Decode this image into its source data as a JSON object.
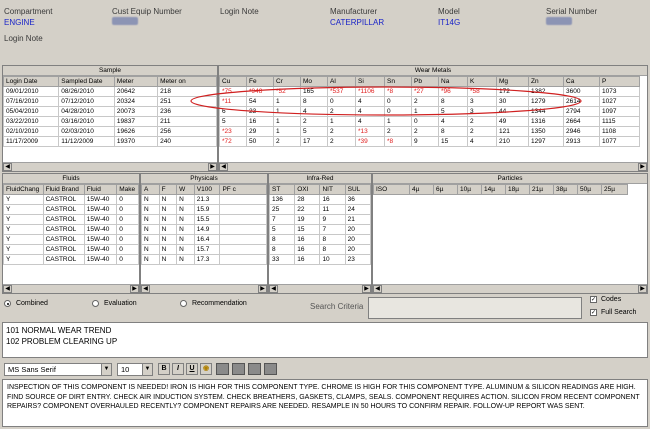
{
  "header": {
    "compartment_label": "Compartment",
    "compartment_value": "ENGINE",
    "login_note_label_left": "Login Note",
    "cust_equip_label": "Cust Equip Number",
    "login_note_label": "Login Note",
    "manufacturer_label": "Manufacturer",
    "manufacturer_value": "CATERPILLAR",
    "model_label": "Model",
    "model_value": "IT14G",
    "serial_label": "Serial Number"
  },
  "sample": {
    "title": "Sample",
    "columns": [
      "Login Date",
      "Sampled Date",
      "Meter",
      "Meter on"
    ],
    "rows": [
      [
        "09/01/2010",
        "08/26/2010",
        "20642",
        "218"
      ],
      [
        "07/16/2010",
        "07/12/2010",
        "20324",
        "251"
      ],
      [
        "05/04/2010",
        "04/28/2010",
        "20073",
        "236"
      ],
      [
        "03/22/2010",
        "03/16/2010",
        "19837",
        "211"
      ],
      [
        "02/10/2010",
        "02/03/2010",
        "19626",
        "256"
      ],
      [
        "11/17/2009",
        "11/12/2009",
        "19370",
        "240"
      ]
    ]
  },
  "wear": {
    "title": "Wear Metals",
    "columns": [
      "Cu",
      "Fe",
      "Cr",
      "Mo",
      "Al",
      "Si",
      "Sn",
      "Pb",
      "Na",
      "K",
      "Mg",
      "Zn",
      "Ca",
      "P"
    ],
    "rows": [
      [
        "*75",
        "*948",
        "*52",
        "165",
        "*537",
        "*1106",
        "*8",
        "*27",
        "*96",
        "*58",
        "172",
        "1382",
        "3600",
        "1073"
      ],
      [
        "*11",
        "54",
        "1",
        "8",
        "0",
        "4",
        "0",
        "2",
        "8",
        "3",
        "30",
        "1279",
        "2614",
        "1027"
      ],
      [
        "6",
        "23",
        "1",
        "4",
        "2",
        "4",
        "0",
        "1",
        "5",
        "3",
        "44",
        "1344",
        "2794",
        "1097"
      ],
      [
        "5",
        "16",
        "1",
        "2",
        "1",
        "4",
        "1",
        "0",
        "4",
        "2",
        "49",
        "1316",
        "2664",
        "1115"
      ],
      [
        "*23",
        "29",
        "1",
        "5",
        "2",
        "*13",
        "2",
        "2",
        "8",
        "2",
        "121",
        "1350",
        "2946",
        "1108"
      ],
      [
        "*72",
        "50",
        "2",
        "17",
        "2",
        "*39",
        "*8",
        "9",
        "15",
        "4",
        "210",
        "1297",
        "2913",
        "1077"
      ]
    ]
  },
  "fluids": {
    "title": "Fluids",
    "columns": [
      "FluidChang",
      "Fluid Brand",
      "Fluid",
      "Make"
    ],
    "rows": [
      [
        "Y",
        "CASTROL",
        "15W-40",
        "0"
      ],
      [
        "Y",
        "CASTROL",
        "15W-40",
        "0"
      ],
      [
        "Y",
        "CASTROL",
        "15W-40",
        "0"
      ],
      [
        "Y",
        "CASTROL",
        "15W-40",
        "0"
      ],
      [
        "Y",
        "CASTROL",
        "15W-40",
        "0"
      ],
      [
        "Y",
        "CASTROL",
        "15W-40",
        "0"
      ],
      [
        "Y",
        "CASTROL",
        "15W-40",
        "0"
      ]
    ]
  },
  "physicals": {
    "title": "Physicals",
    "columns": [
      "A",
      "F",
      "W",
      "V100",
      "PF c"
    ],
    "rows": [
      [
        "N",
        "N",
        "N",
        "21.3",
        ""
      ],
      [
        "N",
        "N",
        "N",
        "15.9",
        ""
      ],
      [
        "N",
        "N",
        "N",
        "15.5",
        ""
      ],
      [
        "N",
        "N",
        "N",
        "14.9",
        ""
      ],
      [
        "N",
        "N",
        "N",
        "16.4",
        ""
      ],
      [
        "N",
        "N",
        "N",
        "15.7",
        ""
      ],
      [
        "N",
        "N",
        "N",
        "17.3",
        ""
      ]
    ]
  },
  "infrared": {
    "title": "Infra-Red",
    "columns": [
      "ST",
      "OXI",
      "NIT",
      "SUL"
    ],
    "rows": [
      [
        "136",
        "28",
        "16",
        "36"
      ],
      [
        "25",
        "22",
        "11",
        "24"
      ],
      [
        "7",
        "19",
        "9",
        "21"
      ],
      [
        "5",
        "15",
        "7",
        "20"
      ],
      [
        "8",
        "16",
        "8",
        "20"
      ],
      [
        "8",
        "16",
        "8",
        "20"
      ],
      [
        "33",
        "16",
        "10",
        "23"
      ]
    ]
  },
  "particles": {
    "title": "Particles",
    "columns": [
      "ISO",
      "4µ",
      "6µ",
      "10µ",
      "14µ",
      "18µ",
      "21µ",
      "38µ",
      "50µ",
      "25µ"
    ]
  },
  "options": {
    "combined": "Combined",
    "evaluation": "Evaluation",
    "recommendation": "Recommendation",
    "search_label": "Search Criteria",
    "codes": "Codes",
    "full_search": "Full Search"
  },
  "codes_list": [
    "101  NORMAL WEAR TREND",
    "102  PROBLEM CLEARING UP"
  ],
  "toolbar": {
    "font_name": "MS Sans Serif",
    "font_size": "10",
    "bold": "B",
    "italic": "I",
    "underline": "U"
  },
  "comment": "INSPECTION OF THIS COMPONENT IS NEEDED!  IRON IS HIGH FOR THIS COMPONENT TYPE.  CHROME IS HIGH FOR THIS COMPONENT TYPE.  ALUMINUM & SILICON READINGS ARE HIGH.  FIND SOURCE OF DIRT ENTRY.  CHECK AIR INDUCTION SYSTEM.  CHECK BREATHERS, GASKETS, CLAMPS, SEALS.  COMPONENT REQUIRES ACTION.  SILICON FROM RECENT COMPONENT REPAIRS?  COMPONENT OVERHAULED RECENTLY?  COMPONENT REPAIRS ARE NEEDED.  RESAMPLE IN 50 HOURS TO CONFIRM REPAIR.  FOLLOW-UP REPORT WAS SENT.",
  "colors": {
    "header_value": "#1a24c8",
    "flagged": "#e02020",
    "highlight_ring": "#d02020"
  }
}
